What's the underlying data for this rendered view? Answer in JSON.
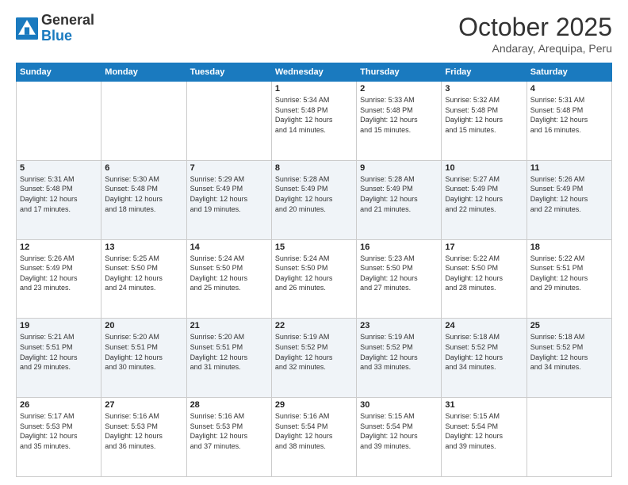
{
  "logo": {
    "general": "General",
    "blue": "Blue"
  },
  "header": {
    "month": "October 2025",
    "location": "Andaray, Arequipa, Peru"
  },
  "weekdays": [
    "Sunday",
    "Monday",
    "Tuesday",
    "Wednesday",
    "Thursday",
    "Friday",
    "Saturday"
  ],
  "weeks": [
    [
      {
        "day": "",
        "info": ""
      },
      {
        "day": "",
        "info": ""
      },
      {
        "day": "",
        "info": ""
      },
      {
        "day": "1",
        "info": "Sunrise: 5:34 AM\nSunset: 5:48 PM\nDaylight: 12 hours\nand 14 minutes."
      },
      {
        "day": "2",
        "info": "Sunrise: 5:33 AM\nSunset: 5:48 PM\nDaylight: 12 hours\nand 15 minutes."
      },
      {
        "day": "3",
        "info": "Sunrise: 5:32 AM\nSunset: 5:48 PM\nDaylight: 12 hours\nand 15 minutes."
      },
      {
        "day": "4",
        "info": "Sunrise: 5:31 AM\nSunset: 5:48 PM\nDaylight: 12 hours\nand 16 minutes."
      }
    ],
    [
      {
        "day": "5",
        "info": "Sunrise: 5:31 AM\nSunset: 5:48 PM\nDaylight: 12 hours\nand 17 minutes."
      },
      {
        "day": "6",
        "info": "Sunrise: 5:30 AM\nSunset: 5:48 PM\nDaylight: 12 hours\nand 18 minutes."
      },
      {
        "day": "7",
        "info": "Sunrise: 5:29 AM\nSunset: 5:49 PM\nDaylight: 12 hours\nand 19 minutes."
      },
      {
        "day": "8",
        "info": "Sunrise: 5:28 AM\nSunset: 5:49 PM\nDaylight: 12 hours\nand 20 minutes."
      },
      {
        "day": "9",
        "info": "Sunrise: 5:28 AM\nSunset: 5:49 PM\nDaylight: 12 hours\nand 21 minutes."
      },
      {
        "day": "10",
        "info": "Sunrise: 5:27 AM\nSunset: 5:49 PM\nDaylight: 12 hours\nand 22 minutes."
      },
      {
        "day": "11",
        "info": "Sunrise: 5:26 AM\nSunset: 5:49 PM\nDaylight: 12 hours\nand 22 minutes."
      }
    ],
    [
      {
        "day": "12",
        "info": "Sunrise: 5:26 AM\nSunset: 5:49 PM\nDaylight: 12 hours\nand 23 minutes."
      },
      {
        "day": "13",
        "info": "Sunrise: 5:25 AM\nSunset: 5:50 PM\nDaylight: 12 hours\nand 24 minutes."
      },
      {
        "day": "14",
        "info": "Sunrise: 5:24 AM\nSunset: 5:50 PM\nDaylight: 12 hours\nand 25 minutes."
      },
      {
        "day": "15",
        "info": "Sunrise: 5:24 AM\nSunset: 5:50 PM\nDaylight: 12 hours\nand 26 minutes."
      },
      {
        "day": "16",
        "info": "Sunrise: 5:23 AM\nSunset: 5:50 PM\nDaylight: 12 hours\nand 27 minutes."
      },
      {
        "day": "17",
        "info": "Sunrise: 5:22 AM\nSunset: 5:50 PM\nDaylight: 12 hours\nand 28 minutes."
      },
      {
        "day": "18",
        "info": "Sunrise: 5:22 AM\nSunset: 5:51 PM\nDaylight: 12 hours\nand 29 minutes."
      }
    ],
    [
      {
        "day": "19",
        "info": "Sunrise: 5:21 AM\nSunset: 5:51 PM\nDaylight: 12 hours\nand 29 minutes."
      },
      {
        "day": "20",
        "info": "Sunrise: 5:20 AM\nSunset: 5:51 PM\nDaylight: 12 hours\nand 30 minutes."
      },
      {
        "day": "21",
        "info": "Sunrise: 5:20 AM\nSunset: 5:51 PM\nDaylight: 12 hours\nand 31 minutes."
      },
      {
        "day": "22",
        "info": "Sunrise: 5:19 AM\nSunset: 5:52 PM\nDaylight: 12 hours\nand 32 minutes."
      },
      {
        "day": "23",
        "info": "Sunrise: 5:19 AM\nSunset: 5:52 PM\nDaylight: 12 hours\nand 33 minutes."
      },
      {
        "day": "24",
        "info": "Sunrise: 5:18 AM\nSunset: 5:52 PM\nDaylight: 12 hours\nand 34 minutes."
      },
      {
        "day": "25",
        "info": "Sunrise: 5:18 AM\nSunset: 5:52 PM\nDaylight: 12 hours\nand 34 minutes."
      }
    ],
    [
      {
        "day": "26",
        "info": "Sunrise: 5:17 AM\nSunset: 5:53 PM\nDaylight: 12 hours\nand 35 minutes."
      },
      {
        "day": "27",
        "info": "Sunrise: 5:16 AM\nSunset: 5:53 PM\nDaylight: 12 hours\nand 36 minutes."
      },
      {
        "day": "28",
        "info": "Sunrise: 5:16 AM\nSunset: 5:53 PM\nDaylight: 12 hours\nand 37 minutes."
      },
      {
        "day": "29",
        "info": "Sunrise: 5:16 AM\nSunset: 5:54 PM\nDaylight: 12 hours\nand 38 minutes."
      },
      {
        "day": "30",
        "info": "Sunrise: 5:15 AM\nSunset: 5:54 PM\nDaylight: 12 hours\nand 39 minutes."
      },
      {
        "day": "31",
        "info": "Sunrise: 5:15 AM\nSunset: 5:54 PM\nDaylight: 12 hours\nand 39 minutes."
      },
      {
        "day": "",
        "info": ""
      }
    ]
  ]
}
